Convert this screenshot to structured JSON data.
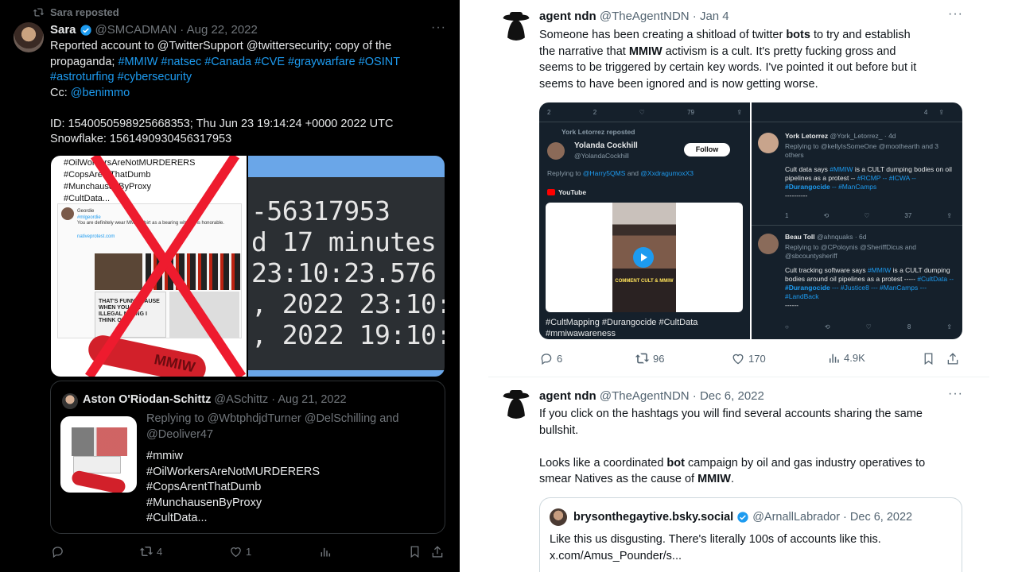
{
  "left": {
    "repost_label": "Sara reposted",
    "tweet": {
      "author": "Sara",
      "handle": "@SMCADMAN",
      "date": "· Aug 22, 2022",
      "line1": "Reported account to @TwitterSupport @twittersecurity; copy of the",
      "line2_prefix": "propaganda; ",
      "hashtags_line2": "#MMIW #natsec #Canada #CVE #graywarfare #OSINT",
      "hashtags_line3": "#astroturfing #cybersecurity",
      "cc_prefix": "Cc: ",
      "cc_handle": "@benimmo",
      "id_line": "ID: 1540050598925668353; Thu Jun 23 19:14:24 +0000 2022 UTC",
      "snowflake_line": "Snowflake: 1561490930456317953"
    },
    "media_left": {
      "tags": [
        "#OilWorkersAreNotMURDERERS",
        "#CopsArentThatDumb",
        "#MunchausenByProxy",
        "#CultData..."
      ],
      "inner_name": "Geordie",
      "inner_reply": "#mlgeordie",
      "inner_text": "You are definitely wear MMIW shirt as a bearing witness is honorable.",
      "inner_link": "nativeprotest.com",
      "shirt_text": "THAT'S FUNNY CAUSE WHEN YOU SAY ILLEGAL MINING I THINK OF",
      "bracelet_text": "MMIW"
    },
    "media_right": {
      "lines": [
        "-56317953",
        "d 17 minutes",
        "23:10:23.576",
        ", 2022 23:10:",
        ", 2022 19:10:"
      ]
    },
    "quote": {
      "author": "Aston O'Riodan-Schittz",
      "handle": "@ASchittz",
      "date": "· Aug 21, 2022",
      "replying": "Replying to @WbtphdjdTurner @DelSchilling and @Deoliver47",
      "lines": [
        "#mmiw",
        "#OilWorkersAreNotMURDERERS",
        "#CopsArentThatDumb",
        "#MunchausenByProxy",
        "#CultData..."
      ]
    },
    "actions": {
      "reposts": "4",
      "likes": "1"
    }
  },
  "right": {
    "tweet1": {
      "author": "agent ndn",
      "handle": "@TheAgentNDN",
      "date": "· Jan 4",
      "lines": [
        [
          "Someone has been creating a shitload of twitter ",
          "bots",
          " to try and establish"
        ],
        [
          "the narrative that ",
          "MMIW",
          " activism is a cult. It's pretty fucking gross and"
        ],
        [
          "seems to be triggered by certain key words. I've pointed it out before but it",
          "",
          ""
        ],
        [
          "seems to have been ignored and is now getting worse.",
          "",
          ""
        ]
      ],
      "stats": {
        "replies": "6",
        "reposts": "96",
        "likes": "170",
        "views": "4.9K"
      }
    },
    "embed_left": {
      "top_stats": [
        "2",
        "2",
        "79"
      ],
      "repost_label": "York Letorrez reposted",
      "name": "Yolanda Cockhill",
      "handle": "@YolandaCockhill",
      "follow": "Follow",
      "replying": "Replying to @Harry5QMS and @XxdragumoxX3",
      "youtube": "YouTube",
      "video_caption": "COMMENT CULT & MMIW",
      "hashtags": "#CultMapping #Durangocide #CultData",
      "hashtags2": "#mmiwawareness"
    },
    "embed_right": {
      "top_stats": [
        "4"
      ],
      "user1": {
        "name": "York Letorrez",
        "handle": "@York_Letorrez_ · 4d",
        "replying": "Replying to @kellyIsSomeOne @moothearth and 3 others",
        "text_a": "Cult data says ",
        "tag_a": "#MMIW",
        "text_b": " is a CULT dumping bodies on oil pipelines as a protest -- ",
        "tags_c": "#RCMP -- #ICWA -- ",
        "tag_bold": "#Durangocide",
        "tags_d": " -- #ManCamps",
        "tail": "----------",
        "stats": [
          "1",
          "37"
        ]
      },
      "user2": {
        "name": "Beau Toll",
        "handle": "@ahnquaks · 6d",
        "replying": "Replying to @CPoloynis @SheriffDicus and @sbcountysheriff",
        "text_a": "Cult tracking software says ",
        "tag_a": "#MMIW",
        "text_b": " is a CULT dumping bodies around oil pipelines as a protest ----- ",
        "tags_c": "#CultData -- ",
        "tag_bold": "#Durangocide",
        "tags_d": " --- #Justice8 --- #ManCamps --- #LandBack",
        "tail": "------",
        "stats": [
          "8"
        ]
      }
    },
    "tweet2": {
      "author": "agent ndn",
      "handle": "@TheAgentNDN",
      "date": "· Dec 6, 2022",
      "p1_line1": "If you click on the hashtags you will find several accounts sharing the same",
      "p1_line2": "bullshit.",
      "p2_line1_a": "Looks like a coordinated ",
      "p2_line1_b": "bot",
      "p2_line1_c": " campaign by oil and gas industry operatives to",
      "p2_line2_a": "smear Natives as the cause of ",
      "p2_line2_b": "MMIW",
      "p2_line2_c": "."
    },
    "quote": {
      "author": "brysonthegaytive.bsky.social",
      "handle": "@ArnallLabrador",
      "date": "· Dec 6, 2022",
      "line1": "Like this us disgusting.  There's literally 100s of accounts like this.",
      "line2": "x.com/Amus_Pounder/s..."
    }
  },
  "colors": {
    "link": "#1d9bf0",
    "verified": "#1d9bf0",
    "dark_bg": "#000000",
    "muted": "#71767b"
  }
}
